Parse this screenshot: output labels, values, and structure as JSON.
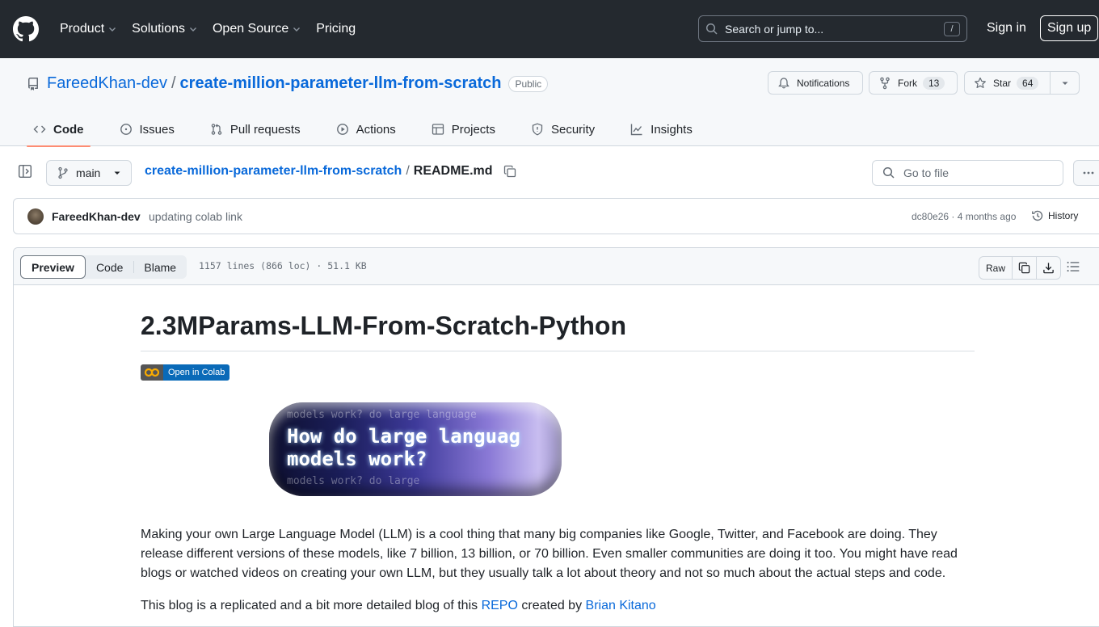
{
  "header": {
    "nav": [
      {
        "label": "Product",
        "has_menu": true
      },
      {
        "label": "Solutions",
        "has_menu": true
      },
      {
        "label": "Open Source",
        "has_menu": true
      },
      {
        "label": "Pricing",
        "has_menu": false
      }
    ],
    "search_placeholder": "Search or jump to...",
    "search_shortcut": "/",
    "sign_in": "Sign in",
    "sign_up": "Sign up"
  },
  "repo": {
    "owner": "FareedKhan-dev",
    "separator": "/",
    "name": "create-million-parameter-llm-from-scratch",
    "visibility": "Public",
    "notifications_label": "Notifications",
    "fork_label": "Fork",
    "fork_count": "13",
    "star_label": "Star",
    "star_count": "64"
  },
  "tabs": [
    {
      "label": "Code",
      "icon": "code-icon",
      "active": true
    },
    {
      "label": "Issues",
      "icon": "issue-icon",
      "active": false
    },
    {
      "label": "Pull requests",
      "icon": "pull-request-icon",
      "active": false
    },
    {
      "label": "Actions",
      "icon": "play-icon",
      "active": false
    },
    {
      "label": "Projects",
      "icon": "table-icon",
      "active": false
    },
    {
      "label": "Security",
      "icon": "shield-icon",
      "active": false
    },
    {
      "label": "Insights",
      "icon": "graph-icon",
      "active": false
    }
  ],
  "file_nav": {
    "branch": "main",
    "breadcrumb_repo": "create-million-parameter-llm-from-scratch",
    "breadcrumb_sep": "/",
    "file_name": "README.md",
    "goto_placeholder": "Go to file"
  },
  "commit": {
    "author": "FareedKhan-dev",
    "message": "updating colab link",
    "meta": "dc80e26 · 4 months ago",
    "history_label": "History"
  },
  "file_view": {
    "modes": [
      "Preview",
      "Code",
      "Blame"
    ],
    "active_mode": "Preview",
    "info": "1157 lines (866 loc) · 51.1 KB",
    "raw_label": "Raw"
  },
  "readme": {
    "title": "2.3MParams-LLM-From-Scratch-Python",
    "badge_label": "Open in Colab",
    "hero_line1": "How do large languag",
    "hero_line2": "models work?",
    "hero_ghost1": "models work?  do large language",
    "hero_ghost2": "models work? do large",
    "paragraph1": "Making your own Large Language Model (LLM) is a cool thing that many big companies like Google, Twitter, and Facebook are doing. They release different versions of these models, like 7 billion, 13 billion, or 70 billion. Even smaller communities are doing it too. You might have read blogs or watched videos on creating your own LLM, but they usually talk a lot about theory and not so much about the actual steps and code.",
    "paragraph2_prefix": "This blog is a replicated and a bit more detailed blog of this ",
    "paragraph2_link1": "REPO",
    "paragraph2_middle": " created by ",
    "paragraph2_link2": "Brian Kitano"
  },
  "colors": {
    "header_bg": "#24292f",
    "link": "#0969da",
    "active_tab_underline": "#fd8c73",
    "colab_badge": "#0a6ab8"
  }
}
